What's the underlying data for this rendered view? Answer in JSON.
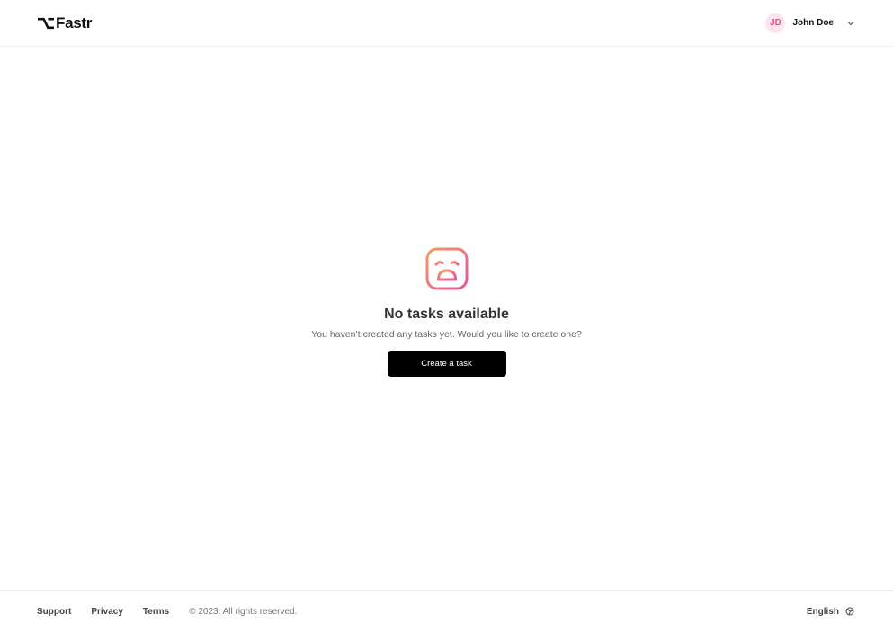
{
  "header": {
    "logo_text": "Fastr",
    "user": {
      "initials": "JD",
      "name": "John Doe"
    }
  },
  "empty_state": {
    "title": "No tasks available",
    "description": "You haven’t created any tasks yet. Would you like to create one?",
    "button_label": "Create a task"
  },
  "footer": {
    "links": [
      "Support",
      "Privacy",
      "Terms"
    ],
    "copyright": "© 2023. All rights reserved.",
    "language": "English"
  },
  "colors": {
    "accent_gradient_start": "#f29a62",
    "accent_gradient_end": "#e8559d",
    "avatar_bg": "#fde3ee",
    "avatar_text": "#ec4f8c",
    "button_bg": "#000000"
  }
}
